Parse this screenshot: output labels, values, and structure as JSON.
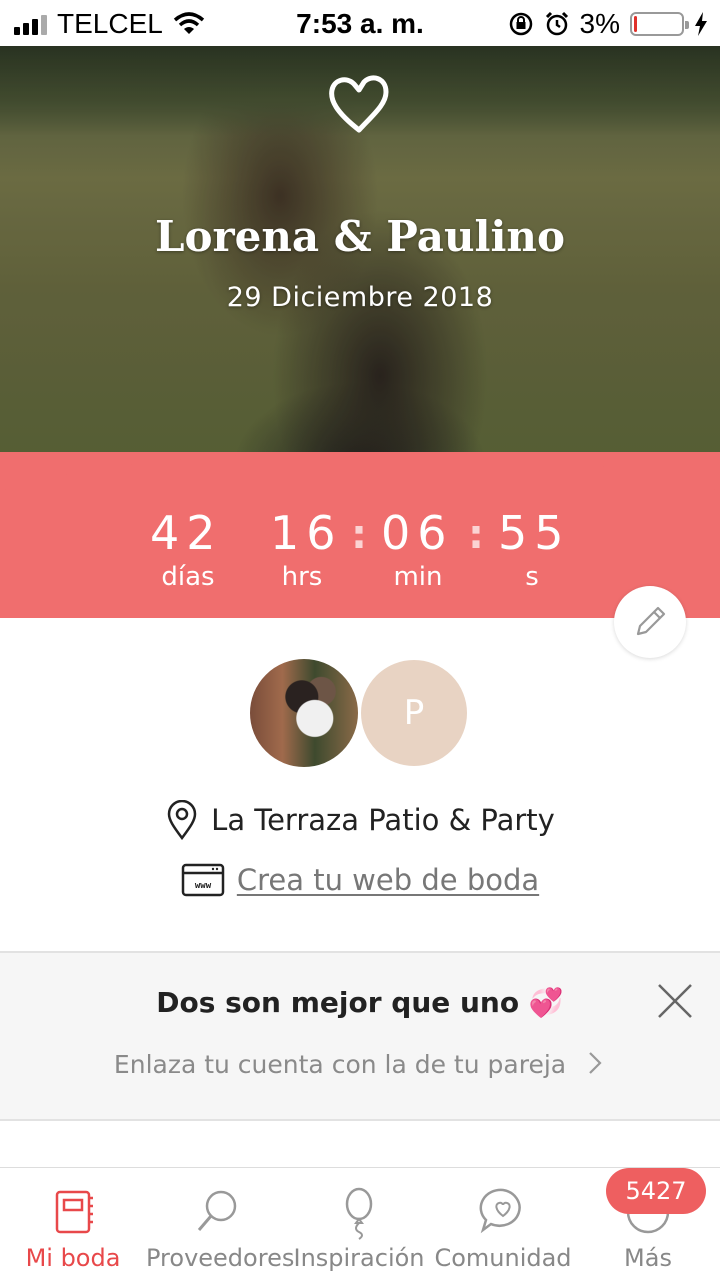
{
  "status_bar": {
    "carrier": "TELCEL",
    "time": "7:53 a. m.",
    "battery": "3%",
    "icons": [
      "signal-icon",
      "wifi-icon",
      "rotation-lock-icon",
      "alarm-icon",
      "battery-icon",
      "charging-icon"
    ]
  },
  "hero": {
    "names": "Lorena & Paulino",
    "date": "29 Diciembre 2018",
    "icon": "heart-icon"
  },
  "countdown": {
    "days": "42",
    "hours": "16",
    "minutes": "06",
    "seconds": "55",
    "days_label": "días",
    "hours_label": "hrs",
    "minutes_label": "min",
    "seconds_label": "s",
    "color": "#f06e6e"
  },
  "profile": {
    "partner_initial": "P",
    "venue": "La Terraza Patio & Party",
    "web_link": "Crea tu web de boda"
  },
  "banner": {
    "title": "Dos son mejor que uno",
    "emoji": "💞",
    "link": "Enlaza tu cuenta con la de tu pareja"
  },
  "tab_bar": {
    "tabs": [
      {
        "label": "Mi boda",
        "icon": "planner-icon",
        "active": true
      },
      {
        "label": "Proveedores",
        "icon": "magnifier-icon",
        "active": false
      },
      {
        "label": "Inspiración",
        "icon": "balloon-icon",
        "active": false
      },
      {
        "label": "Comunidad",
        "icon": "chat-heart-icon",
        "active": false
      },
      {
        "label": "Más",
        "icon": "more-icon",
        "active": false
      }
    ],
    "badge": "5427",
    "accent": "#e8484a"
  }
}
